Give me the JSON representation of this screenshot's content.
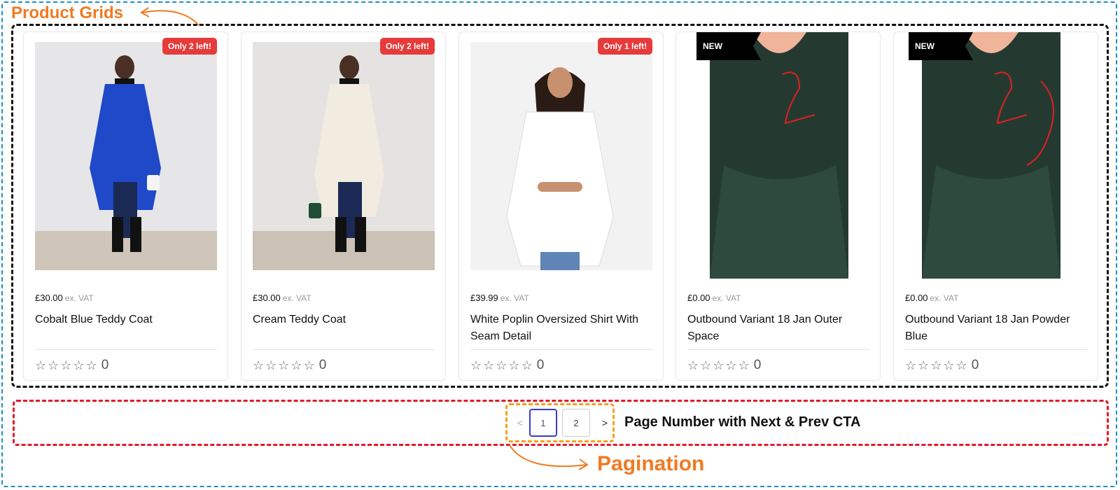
{
  "annotations": {
    "product_grids": "Product Grids",
    "pagination": "Pagination",
    "pagination_note": "Page Number with Next & Prev CTA"
  },
  "products": [
    {
      "price": "£30.00",
      "vat": "ex. VAT",
      "name": "Cobalt Blue Teddy Coat",
      "badge": "Only 2 left!",
      "badge_type": "stock",
      "rating_count": "0",
      "image": "woman-blue-teddy-coat"
    },
    {
      "price": "£30.00",
      "vat": "ex. VAT",
      "name": "Cream Teddy Coat",
      "badge": "Only 2 left!",
      "badge_type": "stock",
      "rating_count": "0",
      "image": "woman-cream-teddy-coat"
    },
    {
      "price": "£39.99",
      "vat": "ex. VAT",
      "name": "White Poplin Oversized Shirt With Seam Detail",
      "badge": "Only 1 left!",
      "badge_type": "stock",
      "rating_count": "0",
      "image": "woman-white-shirt"
    },
    {
      "price": "£0.00",
      "vat": "ex. VAT",
      "name": "Outbound Variant 18 Jan Outer Space",
      "badge": "NEW",
      "badge_type": "new",
      "rating_count": "0",
      "image": "dark-green-velvet-dress"
    },
    {
      "price": "£0.00",
      "vat": "ex. VAT",
      "name": "Outbound Variant 18 Jan Powder Blue",
      "badge": "NEW",
      "badge_type": "new",
      "rating_count": "0",
      "image": "dark-green-velvet-dress"
    }
  ],
  "pagination": {
    "prev": "<",
    "pages": [
      "1",
      "2"
    ],
    "current": "1",
    "next": ">"
  },
  "colors": {
    "stock_badge": "#e63b3b",
    "new_badge": "#000000",
    "annotation_orange": "#f07a22",
    "outer_frame": "#1e8fc8",
    "pagination_frame": "#e21b2a",
    "active_page": "#3b3bc9"
  }
}
